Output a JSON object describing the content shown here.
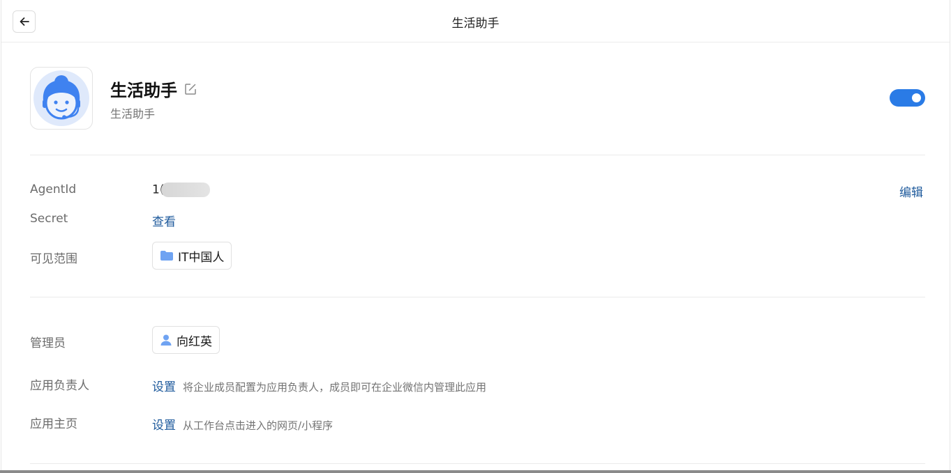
{
  "header": {
    "title": "生活助手",
    "back_icon": "arrow-left-icon"
  },
  "app": {
    "name": "生活助手",
    "description": "生活助手",
    "avatar_icon": "customer-service-avatar-icon",
    "enabled": true,
    "accent_color": "#2a7be6"
  },
  "details": {
    "agentid_label": "AgentId",
    "agentid_value": "1(",
    "secret_label": "Secret",
    "secret_link": "查看",
    "visibility_label": "可见范围",
    "visibility_value": "IT中国人",
    "edit_link": "编辑"
  },
  "management": {
    "admin_label": "管理员",
    "admin_value": "向红英",
    "owner_label": "应用负责人",
    "owner_link": "设置",
    "owner_hint": "将企业成员配置为应用负责人，成员即可在企业微信内管理此应用",
    "homepage_label": "应用主页",
    "homepage_link": "设置",
    "homepage_hint": "从工作台点击进入的网页/小程序"
  }
}
